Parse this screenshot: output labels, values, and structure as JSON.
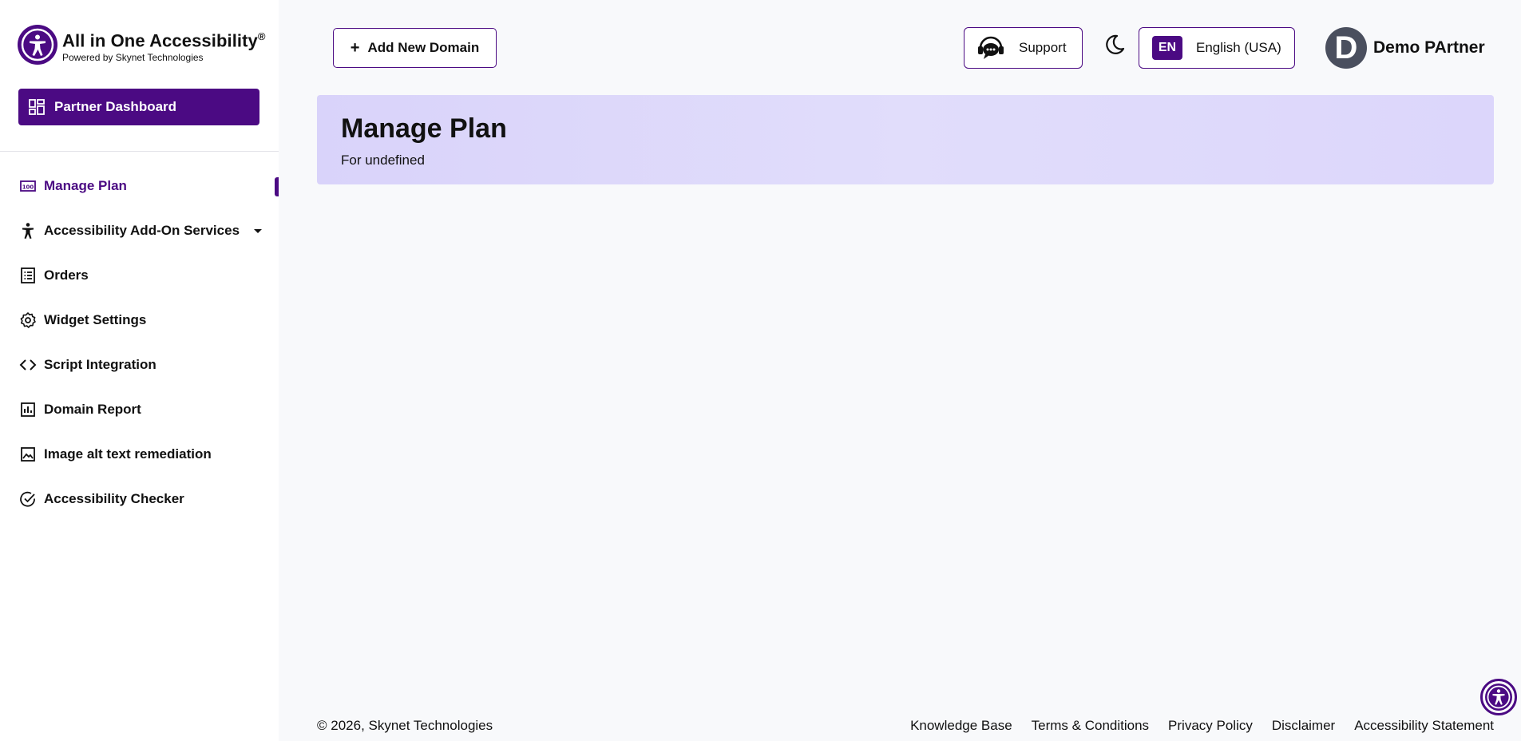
{
  "brand": {
    "title": "All in One Accessibility",
    "registered": "®",
    "subtitle": "Powered by Skynet Technologies"
  },
  "sidebar": {
    "partner_button": "Partner Dashboard",
    "items": [
      {
        "label": "Manage Plan",
        "icon": "plan-icon",
        "active": true
      },
      {
        "label": "Accessibility Add-On Services",
        "icon": "accessibility-person-icon",
        "has_dropdown": true
      },
      {
        "label": "Orders",
        "icon": "orders-list-icon"
      },
      {
        "label": "Widget Settings",
        "icon": "gear-icon"
      },
      {
        "label": "Script Integration",
        "icon": "code-icon"
      },
      {
        "label": "Domain Report",
        "icon": "bar-chart-icon"
      },
      {
        "label": "Image alt text remediation",
        "icon": "image-icon"
      },
      {
        "label": "Accessibility Checker",
        "icon": "check-circle-icon"
      }
    ]
  },
  "header": {
    "add_domain": "Add New Domain",
    "support": "Support",
    "language_code": "EN",
    "language_name": "English (USA)",
    "avatar_initial": "D",
    "user_name": "Demo PArtner"
  },
  "banner": {
    "title": "Manage Plan",
    "subtitle": "For undefined"
  },
  "footer": {
    "copyright": "© 2026, Skynet Technologies",
    "links": [
      "Knowledge Base",
      "Terms & Conditions",
      "Privacy Policy",
      "Disclaimer",
      "Accessibility Statement"
    ]
  },
  "colors": {
    "accent": "#4b0a83",
    "banner": "#dcd6fb"
  }
}
